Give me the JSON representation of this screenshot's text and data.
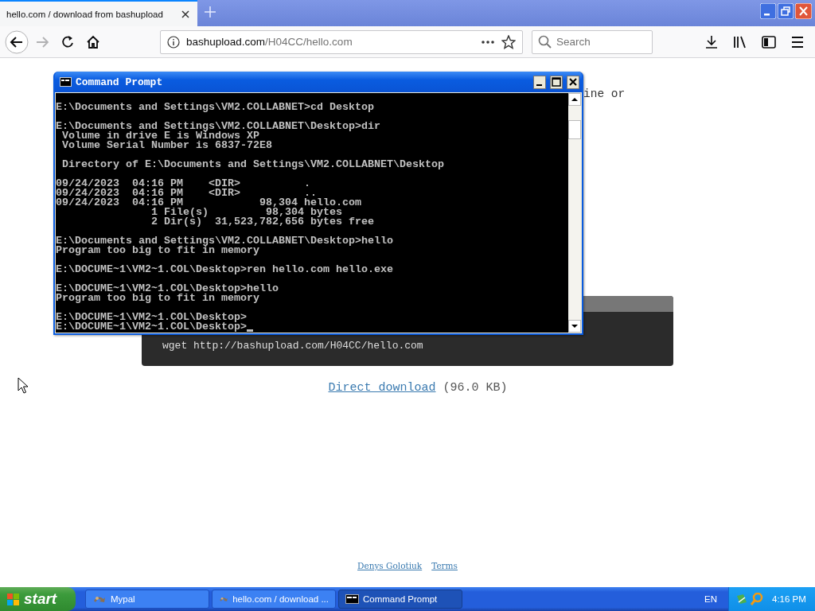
{
  "browser": {
    "tabs": [
      {
        "title": "hello.com / download from bashupload",
        "selected": true
      }
    ],
    "address": {
      "domain": "bashupload.com",
      "path": "/H04CC/hello.com"
    },
    "search": {
      "placeholder": "Search"
    }
  },
  "page": {
    "text_fragment": "ine or",
    "command": "wget http://bashupload.com/H04CC/hello.com",
    "download_link": "Direct download",
    "download_size": "(96.0 KB)",
    "footer_links": [
      "Denys Golotiuk",
      "Terms"
    ]
  },
  "console": {
    "title": "Command Prompt",
    "blocks": [
      [
        "E:\\Documents and Settings\\VM2.COLLABNET>cd Desktop"
      ],
      [
        "E:\\Documents and Settings\\VM2.COLLABNET\\Desktop>dir",
        " Volume in drive E is Windows XP",
        " Volume Serial Number is 6837-72E8"
      ],
      [
        " Directory of E:\\Documents and Settings\\VM2.COLLABNET\\Desktop"
      ],
      [
        "09/24/2023  04:16 PM    <DIR>          .",
        "09/24/2023  04:16 PM    <DIR>          ..",
        "09/24/2023  04:16 PM            98,304 hello.com",
        "               1 File(s)         98,304 bytes",
        "               2 Dir(s)  31,523,782,656 bytes free"
      ],
      [
        "E:\\Documents and Settings\\VM2.COLLABNET\\Desktop>hello",
        "Program too big to fit in memory"
      ],
      [
        "E:\\DOCUME~1\\VM2~1.COL\\Desktop>ren hello.com hello.exe"
      ],
      [
        "E:\\DOCUME~1\\VM2~1.COL\\Desktop>hello",
        "Program too big to fit in memory"
      ],
      [
        "E:\\DOCUME~1\\VM2~1.COL\\Desktop>",
        "E:\\DOCUME~1\\VM2~1.COL\\Desktop>"
      ]
    ]
  },
  "taskbar": {
    "start": "start",
    "tasks": [
      {
        "label": "Mypal",
        "kind": "browser",
        "selected": false
      },
      {
        "label": "hello.com / download ...",
        "kind": "browser",
        "selected": false
      },
      {
        "label": "Command Prompt",
        "kind": "console",
        "selected": true
      }
    ],
    "language": "EN",
    "clock": "4:16 PM"
  }
}
